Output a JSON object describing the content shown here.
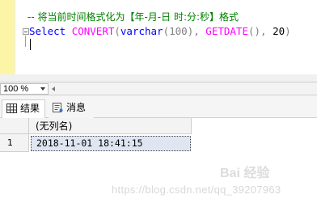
{
  "editor": {
    "comment_line": "-- 将当前时间格式化为【年-月-日 时:分:秒】格式",
    "sql": {
      "select_kw": "Select",
      "convert_fn": "CONVERT",
      "paren_open": "(",
      "varchar_kw": "varchar",
      "length": "(100)",
      "comma1": ", ",
      "getdate_fn": "GETDATE",
      "getdate_parens": "()",
      "comma2": ", ",
      "style_code": "20",
      "paren_close": ")"
    }
  },
  "zoom": {
    "value": "100 %"
  },
  "tabs": [
    {
      "label": "结果",
      "icon": "grid-icon"
    },
    {
      "label": "消息",
      "icon": "message-icon"
    }
  ],
  "results": {
    "columns": [
      "(无列名)"
    ],
    "rows": [
      {
        "index": "1",
        "cells": [
          "2018-11-01 18:41:15"
        ]
      }
    ]
  },
  "watermark": {
    "url": "https://blog.csdn.net/qq_39207963",
    "logo": "Bai 经验"
  },
  "colors": {
    "gutter": "#fdf5a6",
    "comment": "#008000",
    "keyword": "#0000ff",
    "function": "#ff00ff",
    "selected_cell": "#dfe6f2"
  }
}
